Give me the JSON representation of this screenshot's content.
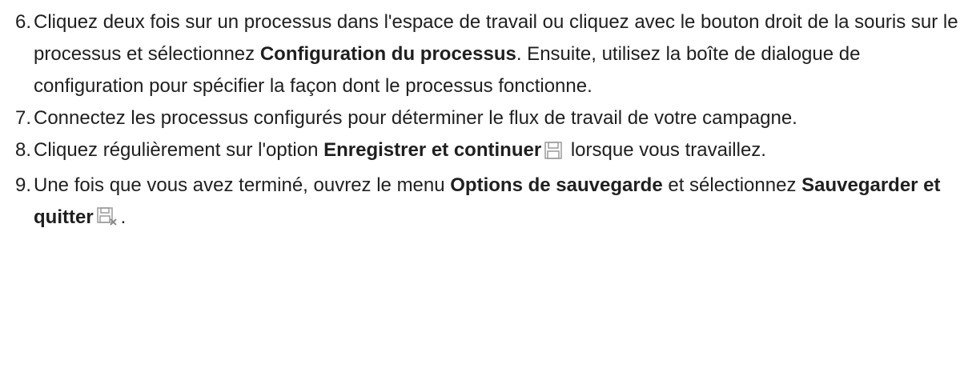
{
  "steps": [
    {
      "number": "6.",
      "text_1": "Cliquez deux fois sur un processus dans l'espace de travail ou cliquez avec le bouton droit de la souris sur le processus et sélectionnez ",
      "bold_1": "Configuration du processus",
      "text_2": ". Ensuite, utilisez la boîte de dialogue de configuration pour spécifier la façon dont le processus fonctionne."
    },
    {
      "number": "7.",
      "text_1": "Connectez les processus configurés pour déterminer le flux de travail de votre campagne."
    },
    {
      "number": "8.",
      "text_1": "Cliquez régulièrement sur l'option ",
      "bold_1": "Enregistrer et continuer",
      "icon": "save-icon",
      "text_2": " lorsque vous travaillez."
    },
    {
      "number": "9.",
      "text_1": "Une fois que vous avez terminé, ouvrez le menu ",
      "bold_1": "Options de sauvegarde",
      "text_2": " et sélectionnez ",
      "bold_2": "Sauvegarder et quitter",
      "icon": "save-and-exit-icon",
      "text_3": "."
    }
  ],
  "colors": {
    "text": "#1f1f1f",
    "icon": "#9a9a9a"
  }
}
